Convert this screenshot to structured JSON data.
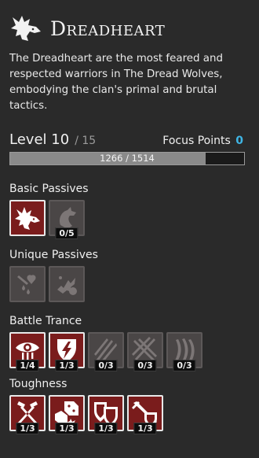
{
  "class": {
    "title": "Dreadheart",
    "description": "The Dreadheart are the most feared and respected warriors in The Dread Wolves, embodying the clan's primal and brutal tactics.",
    "icon": "wolf-head-icon"
  },
  "progress": {
    "level_label": "Level 10",
    "level_max": "/ 15",
    "focus_label": "Focus Points",
    "focus_value": "0",
    "xp_text": "1266 / 1514",
    "xp_fraction": 0.836
  },
  "sections": {
    "basic": {
      "title": "Basic Passives",
      "skills": [
        {
          "icon": "wolf-head-icon",
          "state": "active"
        },
        {
          "icon": "howling-wolf-icon",
          "state": "inactive",
          "rank": "0/5"
        }
      ]
    },
    "unique": {
      "title": "Unique Passives",
      "skills": [
        {
          "icon": "bleeding-heart-icon",
          "state": "inactive"
        },
        {
          "icon": "blood-splash-icon",
          "state": "inactive"
        }
      ]
    },
    "trance": {
      "title": "Battle Trance",
      "skills": [
        {
          "icon": "bleeding-eye-icon",
          "state": "active",
          "rank": "1/4"
        },
        {
          "icon": "bleeding-claw-icon",
          "state": "active",
          "rank": "1/3"
        },
        {
          "icon": "claw-slash-icon",
          "state": "inactive",
          "rank": "0/3"
        },
        {
          "icon": "cross-slash-icon",
          "state": "inactive",
          "rank": "0/3"
        },
        {
          "icon": "claw-marks-icon",
          "state": "inactive",
          "rank": "0/3"
        }
      ]
    },
    "tough": {
      "title": "Toughness",
      "skills": [
        {
          "icon": "crossed-hammers-icon",
          "state": "active",
          "rank": "1/3"
        },
        {
          "icon": "dice-icon",
          "state": "active",
          "rank": "1/3"
        },
        {
          "icon": "shields-icon",
          "state": "active",
          "rank": "1/3"
        },
        {
          "icon": "shield-spear-icon",
          "state": "active",
          "rank": "1/3"
        }
      ]
    }
  },
  "colors": {
    "active_bg": "#7a1c1c",
    "inactive_bg": "#4a4646",
    "focus_accent": "#3fb6e6"
  }
}
